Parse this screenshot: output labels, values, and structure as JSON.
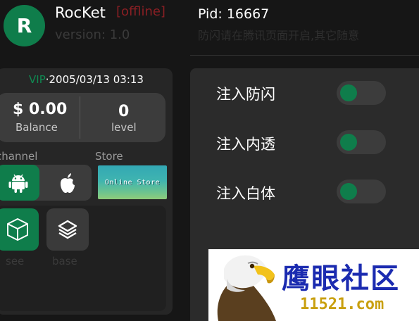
{
  "profile": {
    "avatar_letter": "R",
    "app_name": "RocKet",
    "status": "[offline]",
    "version": "version: 1.0"
  },
  "account": {
    "vip_label": "VIP",
    "vip_date": "·2005/03/13  03:13",
    "balance_value": "$ 0.00",
    "balance_label": "Balance",
    "level_value": "0",
    "level_label": "level"
  },
  "sections": {
    "channel_label": "channel",
    "store_label": "Store",
    "online_store_text": "Online Store"
  },
  "tools": [
    {
      "label": "see",
      "icon": "cube-icon"
    },
    {
      "label": "base",
      "icon": "layers-icon"
    }
  ],
  "right": {
    "pid": "Pid: 16667",
    "hint": "防闪请在腾讯页面开启,其它随意",
    "toggles": [
      {
        "label": "注入防闪",
        "on": false
      },
      {
        "label": "注入内透",
        "on": false
      },
      {
        "label": "注入白体",
        "on": false
      }
    ]
  },
  "watermark": {
    "title": "鹰眼社区",
    "url": "11521.com"
  },
  "colors": {
    "accent": "#0f7d4b",
    "offline": "#8a1f24",
    "background": "#161616",
    "panel": "#2b2b2b"
  },
  "icons": [
    "android-icon",
    "apple-icon",
    "cube-icon",
    "layers-icon",
    "eagle-icon"
  ]
}
